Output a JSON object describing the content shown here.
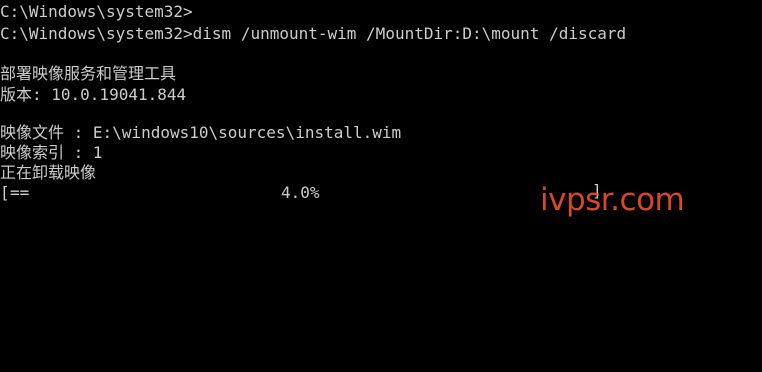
{
  "terminal": {
    "lines": [
      "C:\\Windows\\system32>",
      "C:\\Windows\\system32>dism /unmount-wim /MountDir:D:\\mount /discard",
      "",
      "部署映像服务和管理工具",
      "版本: 10.0.19041.844",
      "",
      "映像文件 : E:\\windows10\\sources\\install.wim",
      "映像索引 : 1",
      "正在卸载映像"
    ],
    "progress": {
      "open_bracket": "[",
      "bar": "==",
      "percent_text": "4.0%",
      "close_bracket": "]",
      "value_percent": 4.0
    },
    "text_color": "#cccccc",
    "background_color": "#000000"
  },
  "watermark": {
    "text": "ivpsr.com",
    "color": "#e8502a"
  }
}
